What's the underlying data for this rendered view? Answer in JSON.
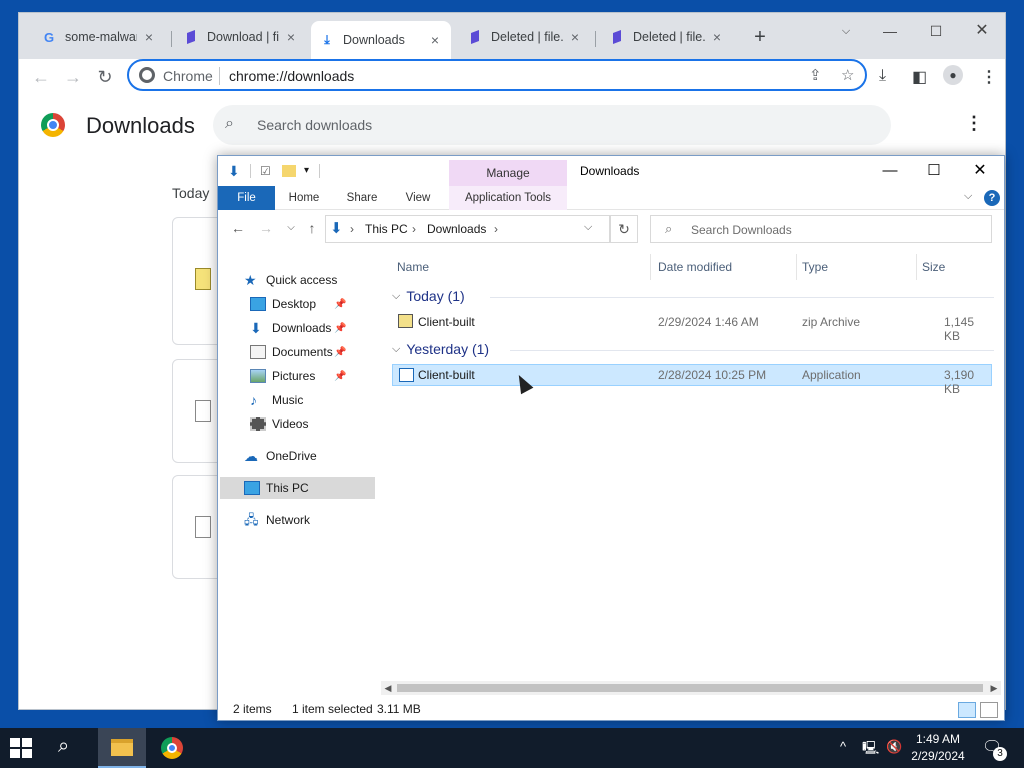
{
  "chrome": {
    "tabs": [
      {
        "title": "some-malware",
        "icon": "google-icon"
      },
      {
        "title": "Download | file",
        "icon": "file-io-icon"
      },
      {
        "title": "Downloads",
        "icon": "download-icon"
      },
      {
        "title": "Deleted | file.io",
        "icon": "file-io-icon"
      },
      {
        "title": "Deleted | file.io",
        "icon": "file-io-icon"
      }
    ],
    "omnibox": {
      "site": "Chrome",
      "url": "chrome://downloads"
    },
    "downloads_page": {
      "title": "Downloads",
      "search_placeholder": "Search downloads",
      "date_group": "Today"
    }
  },
  "explorer": {
    "title": "Downloads",
    "manage_tab": "Manage",
    "ribbon_tabs": [
      "File",
      "Home",
      "Share",
      "View",
      "Application Tools"
    ],
    "breadcrumb": [
      "This PC",
      "Downloads"
    ],
    "search_placeholder": "Search Downloads",
    "nav": [
      {
        "label": "Quick access",
        "icon": "star-icon"
      },
      {
        "label": "Desktop",
        "icon": "desktop-icon",
        "pinned": true
      },
      {
        "label": "Downloads",
        "icon": "download-icon",
        "pinned": true
      },
      {
        "label": "Documents",
        "icon": "documents-icon",
        "pinned": true
      },
      {
        "label": "Pictures",
        "icon": "pictures-icon",
        "pinned": true
      },
      {
        "label": "Music",
        "icon": "music-icon"
      },
      {
        "label": "Videos",
        "icon": "videos-icon"
      },
      {
        "label": "OneDrive",
        "icon": "cloud-icon"
      },
      {
        "label": "This PC",
        "icon": "computer-icon",
        "selected": true
      },
      {
        "label": "Network",
        "icon": "network-icon"
      }
    ],
    "columns": [
      "Name",
      "Date modified",
      "Type",
      "Size"
    ],
    "groups": [
      {
        "label": "Today (1)",
        "files": [
          {
            "name": "Client-built",
            "date": "2/29/2024 1:46 AM",
            "type": "zip Archive",
            "size": "1,145 KB",
            "icon": "zip-file-icon"
          }
        ]
      },
      {
        "label": "Yesterday (1)",
        "files": [
          {
            "name": "Client-built",
            "date": "2/28/2024 10:25 PM",
            "type": "Application",
            "size": "3,190 KB",
            "icon": "application-icon",
            "selected": true
          }
        ]
      }
    ],
    "status": {
      "items": "2 items",
      "selection": "1 item selected",
      "size": "3.11 MB"
    }
  },
  "taskbar": {
    "time": "1:49 AM",
    "date": "2/29/2024",
    "notification_count": "3"
  }
}
